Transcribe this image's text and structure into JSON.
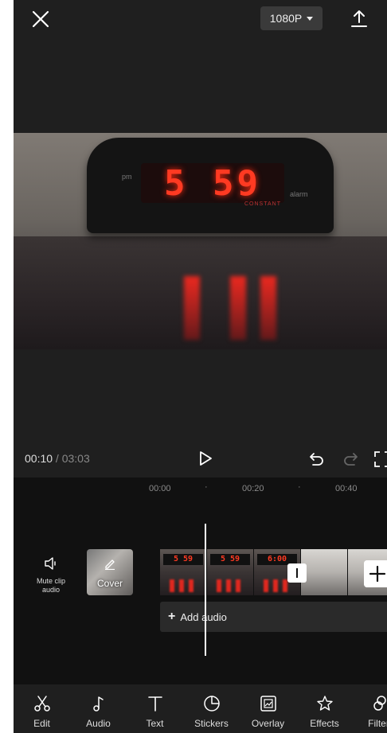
{
  "header": {
    "resolution_label": "1080P",
    "icons": {
      "close": "close-icon",
      "export": "export-icon",
      "dropdown": "chevron-down-icon"
    }
  },
  "preview": {
    "clock_time": "5 59",
    "clock_pm": "pm",
    "clock_alarm": "alarm",
    "clock_brand": "CONSTANT"
  },
  "playback": {
    "current_time": "00:10",
    "separator": " / ",
    "total_time": "03:03",
    "icons": {
      "play": "play-icon",
      "undo": "undo-icon",
      "redo": "redo-icon",
      "fullscreen": "fullscreen-icon"
    }
  },
  "timeline": {
    "ruler": [
      "00:00",
      "00:20",
      "00:40"
    ],
    "mute_label_line1": "Mute clip",
    "mute_label_line2": "audio",
    "cover_label": "Cover",
    "frames": [
      "5 59",
      "5 59",
      "6:00"
    ],
    "add_audio_label": "Add audio"
  },
  "toolbar": {
    "items": [
      {
        "label": "Edit",
        "icon": "scissors-icon"
      },
      {
        "label": "Audio",
        "icon": "music-note-icon"
      },
      {
        "label": "Text",
        "icon": "text-icon"
      },
      {
        "label": "Stickers",
        "icon": "sticker-icon"
      },
      {
        "label": "Overlay",
        "icon": "overlay-icon"
      },
      {
        "label": "Effects",
        "icon": "effects-star-icon"
      },
      {
        "label": "Filters",
        "icon": "filter-icon"
      }
    ]
  },
  "colors": {
    "background": "#1f1f1f",
    "timeline_bg": "#111111",
    "clock_led": "#ff3a22"
  }
}
